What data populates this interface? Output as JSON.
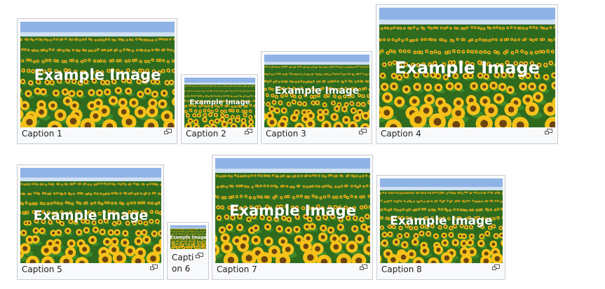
{
  "gallery": {
    "overlay_text": "Example Image",
    "colors": {
      "sky": "#8fb3e6",
      "leaf": "#2f6b1f",
      "petal": "#f6c21a",
      "center": "#6b4410",
      "border": "#c8ccd1",
      "caption_bg": "#f8f9fa"
    },
    "icons": {
      "enlarge": "magnify-clip-icon"
    },
    "items": [
      {
        "caption": "Caption 1"
      },
      {
        "caption": "Caption 2"
      },
      {
        "caption": "Caption 3"
      },
      {
        "caption": "Caption 4"
      },
      {
        "caption": "Caption 5"
      },
      {
        "caption": "Caption 6"
      },
      {
        "caption": "Caption 7"
      },
      {
        "caption": "Caption 8"
      }
    ]
  }
}
